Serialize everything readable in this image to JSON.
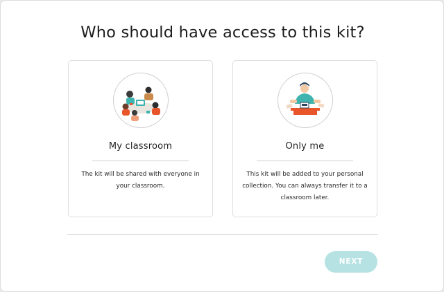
{
  "dialog": {
    "title": "Who should have access to this kit?"
  },
  "options": [
    {
      "title": "My classroom",
      "description": "The kit will be shared with everyone in your classroom.",
      "icon": "classroom-illustration"
    },
    {
      "title": "Only me",
      "description": "This kit will be added to your personal collection. You can always transfer it to a classroom later.",
      "icon": "only-me-illustration"
    }
  ],
  "footer": {
    "next_label": "NEXT"
  },
  "colors": {
    "next_button_disabled": "#b6e2e3",
    "accent_orange": "#e9552b",
    "accent_teal": "#3fb4ae"
  }
}
